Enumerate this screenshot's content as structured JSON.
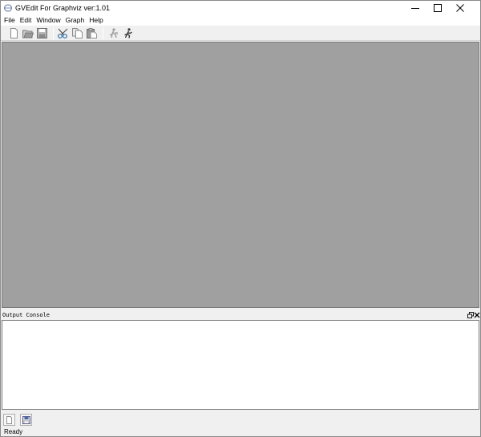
{
  "window": {
    "title": "GVEdit For Graphviz ver:1.01",
    "app_icon": "graphviz-app-icon"
  },
  "title_controls": {
    "minimize": "minimize-icon",
    "maximize": "maximize-icon",
    "close": "close-icon"
  },
  "menubar": {
    "items": [
      {
        "label": "File"
      },
      {
        "label": "Edit"
      },
      {
        "label": "Window"
      },
      {
        "label": "Graph"
      },
      {
        "label": "Help"
      }
    ]
  },
  "toolbar": {
    "buttons": [
      "new-file-icon",
      "open-file-icon",
      "save-file-icon",
      "cut-icon",
      "copy-icon",
      "paste-icon",
      "settings-run-icon",
      "run-icon"
    ]
  },
  "output_console": {
    "title": "Output Console",
    "float_icon": "dock-float-icon",
    "close_icon": "dock-close-icon"
  },
  "bottom_toolbar": {
    "buttons": [
      "new-log-icon",
      "save-log-icon"
    ]
  },
  "statusbar": {
    "text": "Ready"
  }
}
